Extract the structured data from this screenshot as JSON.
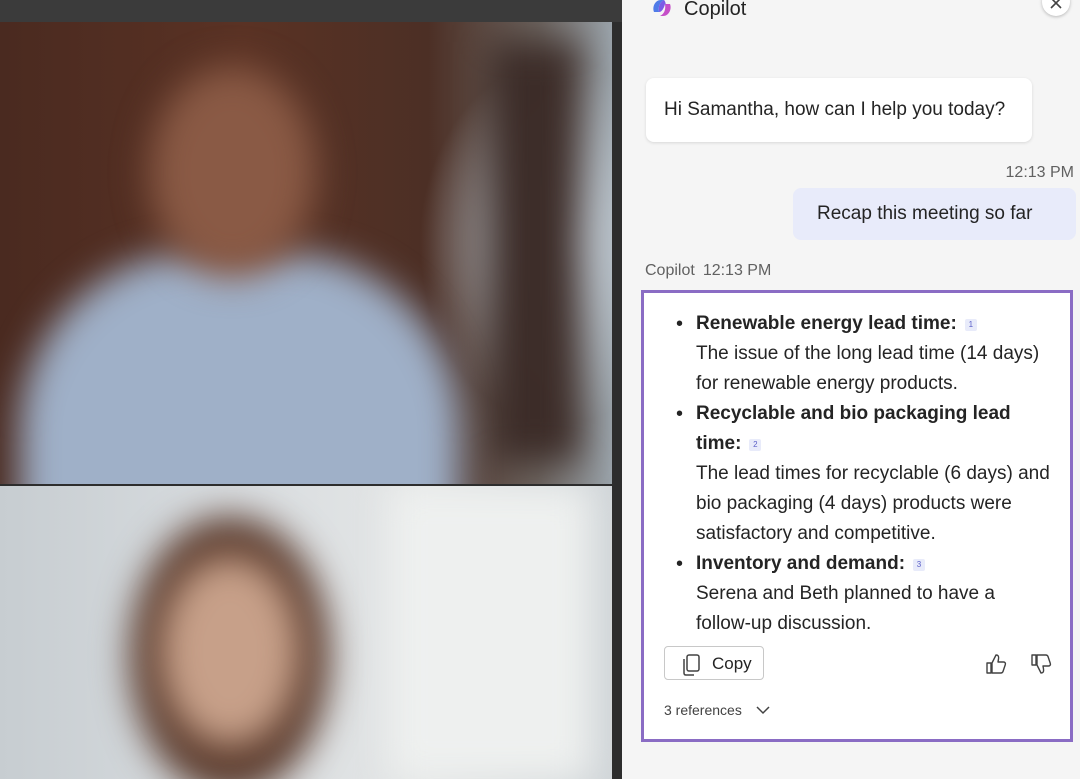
{
  "panel": {
    "title": "Copilot",
    "logo_icon": "copilot-logo-icon",
    "close_icon": "close-icon"
  },
  "chat": {
    "greeting": "Hi Samantha, how can I help you today?",
    "user_message": {
      "time": "12:13 PM",
      "text": "Recap this meeting so far"
    },
    "bot_response": {
      "sender": "Copilot",
      "time": "12:13 PM",
      "items": [
        {
          "heading": "Renewable energy lead time:",
          "citation": "1",
          "detail": "The issue of the long lead time (14 days) for renewable energy products."
        },
        {
          "heading": "Recyclable and bio packaging lead time:",
          "citation": "2",
          "detail": "The lead times for recyclable (6 days) and bio packaging (4 days) products were satisfactory and competitive."
        },
        {
          "heading": "Inventory and demand:",
          "citation": "3",
          "detail": "Serena and Beth planned to have a follow-up discussion."
        }
      ],
      "copy_label": "Copy",
      "references_label": "3 references"
    }
  },
  "colors": {
    "accent": "#8a6cc4",
    "user_bubble": "#e8ebfa",
    "panel_bg": "#f5f5f5"
  }
}
